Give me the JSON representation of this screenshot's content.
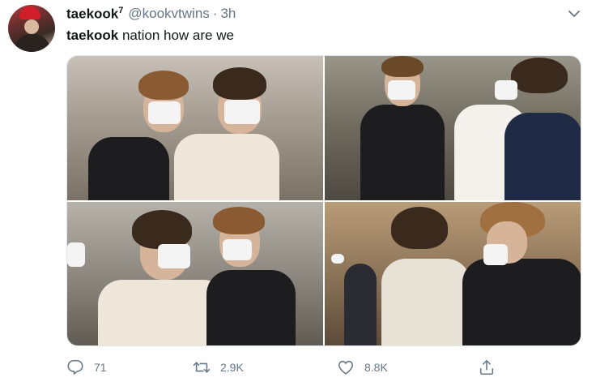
{
  "tweet": {
    "display_name": "taekook",
    "verified_sup": "7",
    "handle": "@kookvtwins",
    "separator": "·",
    "time": "3h",
    "text_bold": "taekook",
    "text_rest": " nation how are we"
  },
  "actions": {
    "reply_count": "71",
    "retweet_count": "2.9K",
    "like_count": "8.8K"
  },
  "icons": {
    "reply": "comment-icon",
    "retweet": "retweet-icon",
    "like": "heart-icon",
    "share": "share-icon",
    "menu": "chevron-down-icon"
  },
  "colors": {
    "text": "#14171a",
    "muted": "#657786",
    "border": "#e1e8ed"
  }
}
